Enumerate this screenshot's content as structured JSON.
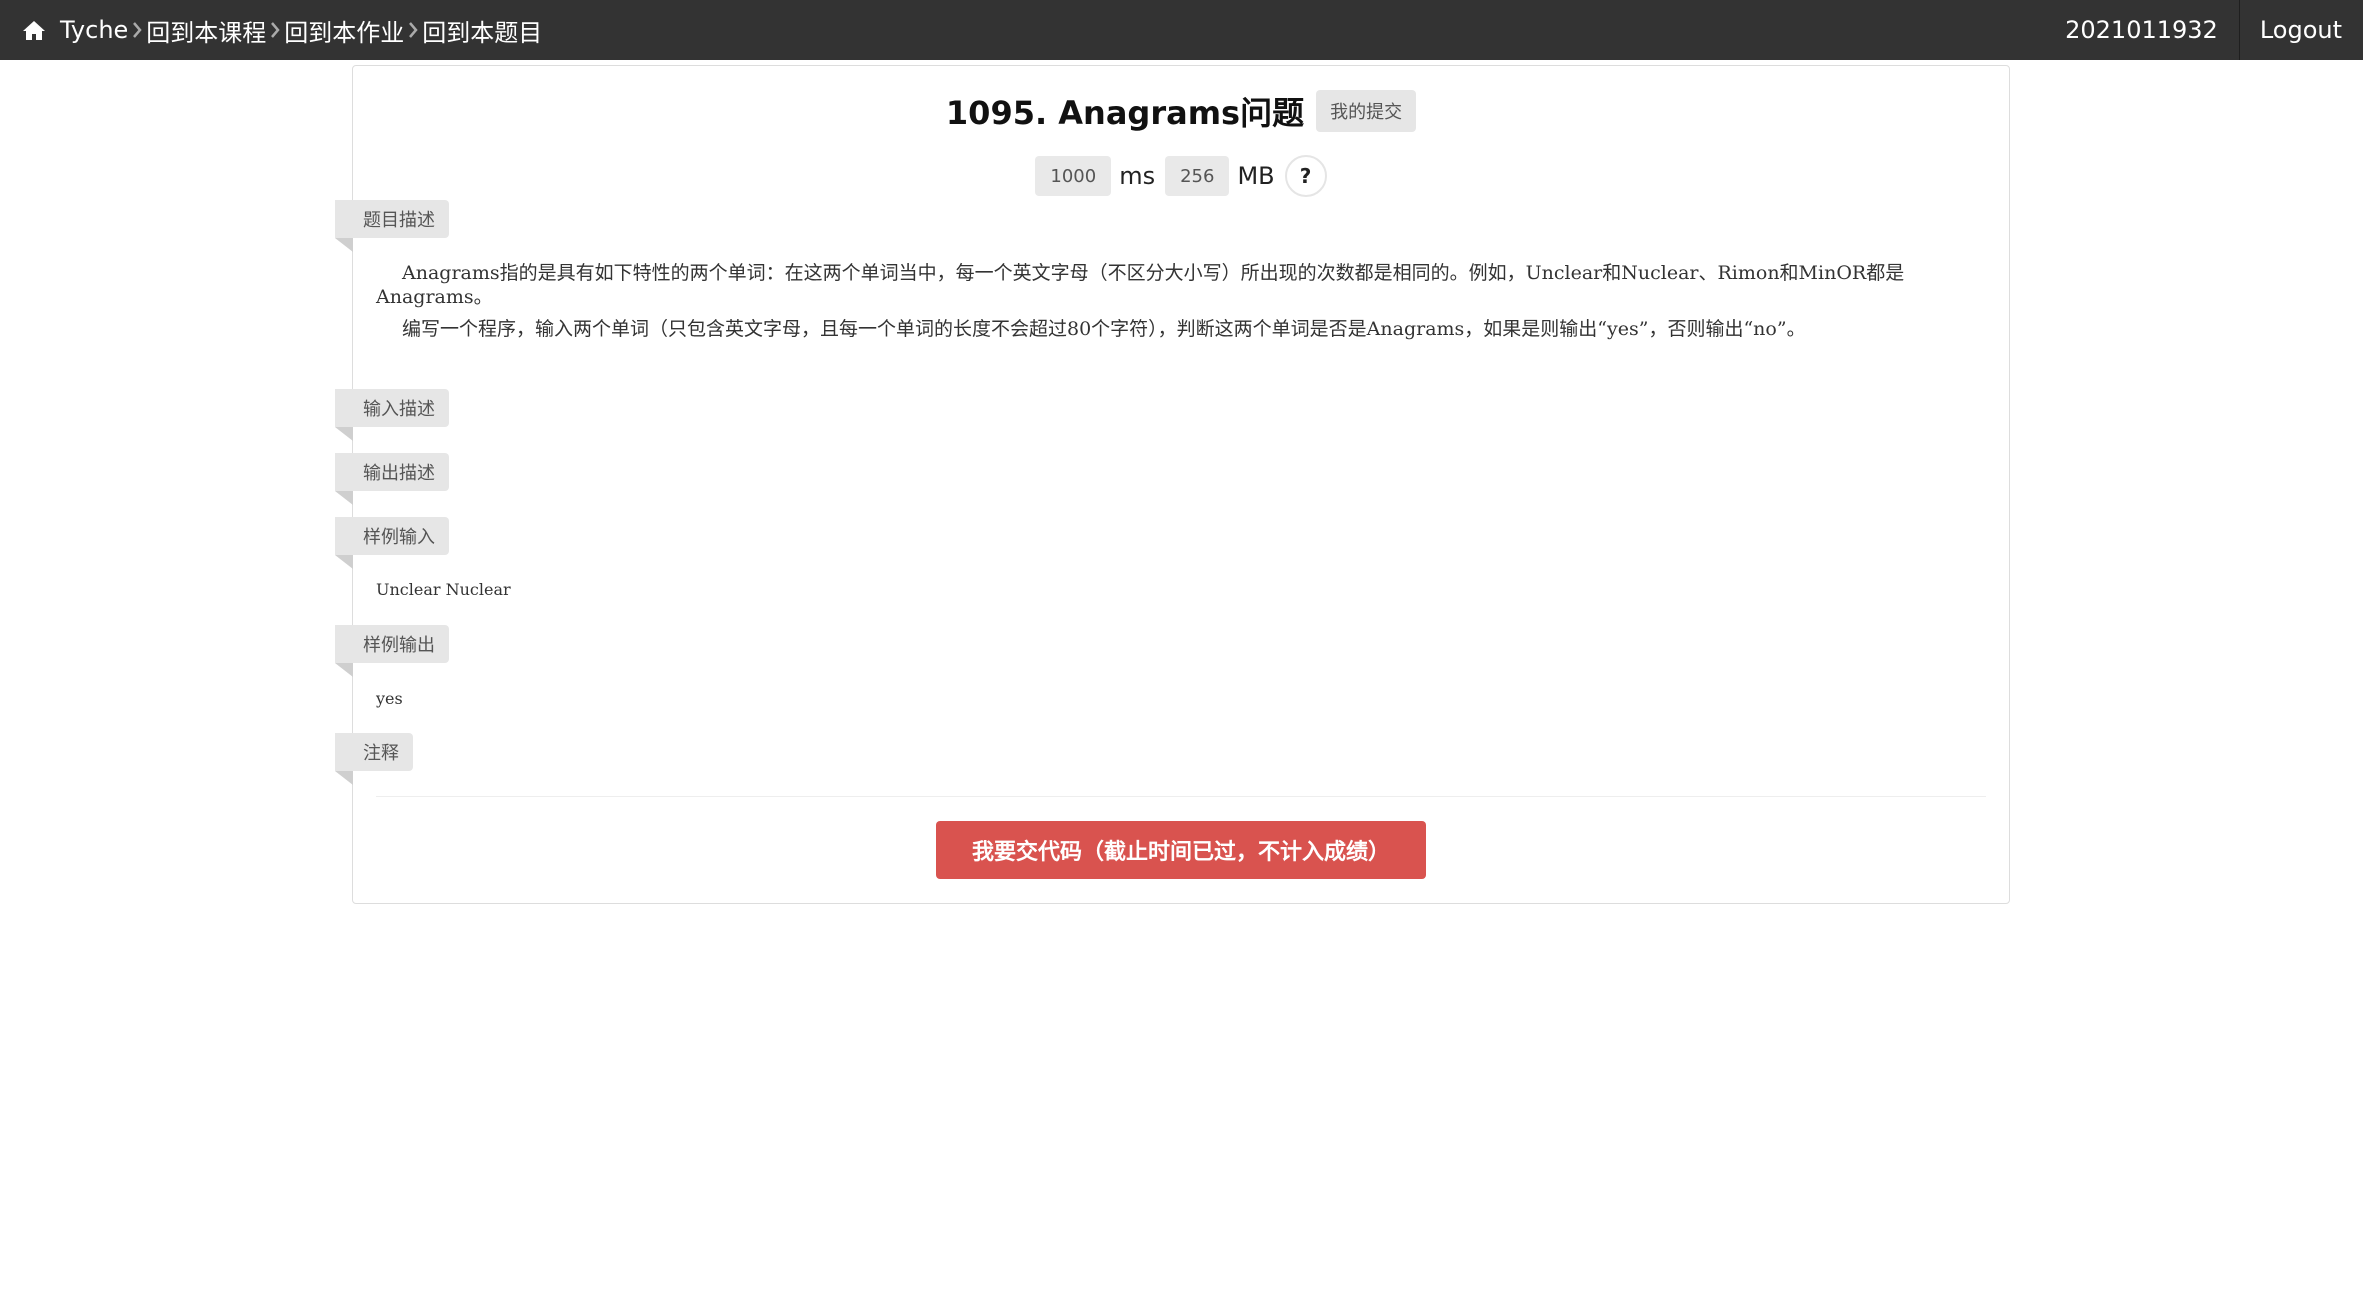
{
  "nav": {
    "home_icon": "home-icon",
    "brand": "Tyche",
    "crumbs": [
      "回到本课程",
      "回到本作业",
      "回到本题目"
    ],
    "user": "2021011932",
    "logout": "Logout"
  },
  "problem": {
    "title": "1095. Anagrams问题",
    "my_submit": "我的提交",
    "time_limit": "1000",
    "time_unit": "ms",
    "memory_limit": "256",
    "memory_unit": "MB",
    "help": "?"
  },
  "sections": {
    "description_label": "题目描述",
    "description_p1": "Anagrams指的是具有如下特性的两个单词：在这两个单词当中，每一个英文字母（不区分大小写）所出现的次数都是相同的。例如，Unclear和Nuclear、Rimon和MinOR都是Anagrams。",
    "description_p2": "编写一个程序，输入两个单词（只包含英文字母，且每一个单词的长度不会超过80个字符），判断这两个单词是否是Anagrams，如果是则输出“yes”，否则输出“no”。",
    "input_label": "输入描述",
    "output_label": "输出描述",
    "sample_input_label": "样例输入",
    "sample_input": "Unclear Nuclear",
    "sample_output_label": "样例输出",
    "sample_output": "yes",
    "note_label": "注释"
  },
  "submit_button": "我要交代码（截止时间已过，不计入成绩）"
}
